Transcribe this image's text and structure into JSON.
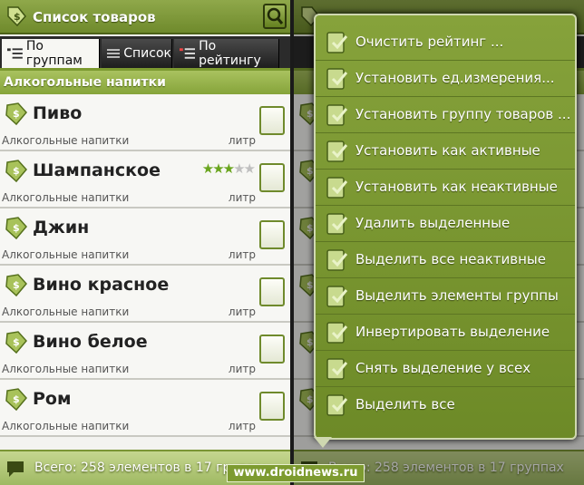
{
  "app": {
    "title": "Список товаров"
  },
  "tabs": [
    {
      "label": "По группам",
      "active": true
    },
    {
      "label": "Список",
      "active": false
    },
    {
      "label": "По рейтингу",
      "active": false
    }
  ],
  "group_header": "Алкогольные напитки",
  "items": [
    {
      "name": "Пиво",
      "group": "Алкогольные напитки",
      "unit": "литр",
      "rating": 0
    },
    {
      "name": "Шампанское",
      "group": "Алкогольные напитки",
      "unit": "литр",
      "rating": 3,
      "rating_max": 5
    },
    {
      "name": "Джин",
      "group": "Алкогольные напитки",
      "unit": "литр",
      "rating": 0
    },
    {
      "name": "Вино красное",
      "group": "Алкогольные напитки",
      "unit": "литр",
      "rating": 0
    },
    {
      "name": "Вино белое",
      "group": "Алкогольные напитки",
      "unit": "литр",
      "rating": 0
    },
    {
      "name": "Ром",
      "group": "Алкогольные напитки",
      "unit": "литр",
      "rating": 0
    }
  ],
  "status_text": "Всего: 258 элементов в 17 группах",
  "context_menu": [
    {
      "label": "Очистить рейтинг ...",
      "icon": "clear-rating-icon"
    },
    {
      "label": "Установить ед.измерения...",
      "icon": "set-unit-icon"
    },
    {
      "label": "Установить группу товаров ...",
      "icon": "set-group-icon"
    },
    {
      "label": "Установить как активные",
      "icon": "set-active-icon"
    },
    {
      "label": "Установить как неактивные",
      "icon": "set-inactive-icon"
    },
    {
      "label": "Удалить выделенные",
      "icon": "delete-icon"
    },
    {
      "label": "Выделить все неактивные",
      "icon": "select-inactive-icon"
    },
    {
      "label": "Выделить элементы группы",
      "icon": "select-group-icon"
    },
    {
      "label": "Инвертировать выделение",
      "icon": "invert-selection-icon"
    },
    {
      "label": "Снять выделение у всех",
      "icon": "deselect-all-icon"
    },
    {
      "label": "Выделить все",
      "icon": "select-all-icon"
    }
  ],
  "watermark": "www.droidnews.ru",
  "colors": {
    "accent": "#7c9a30",
    "accent_dark": "#4c6218",
    "tab_dark": "#2b2b2b"
  }
}
